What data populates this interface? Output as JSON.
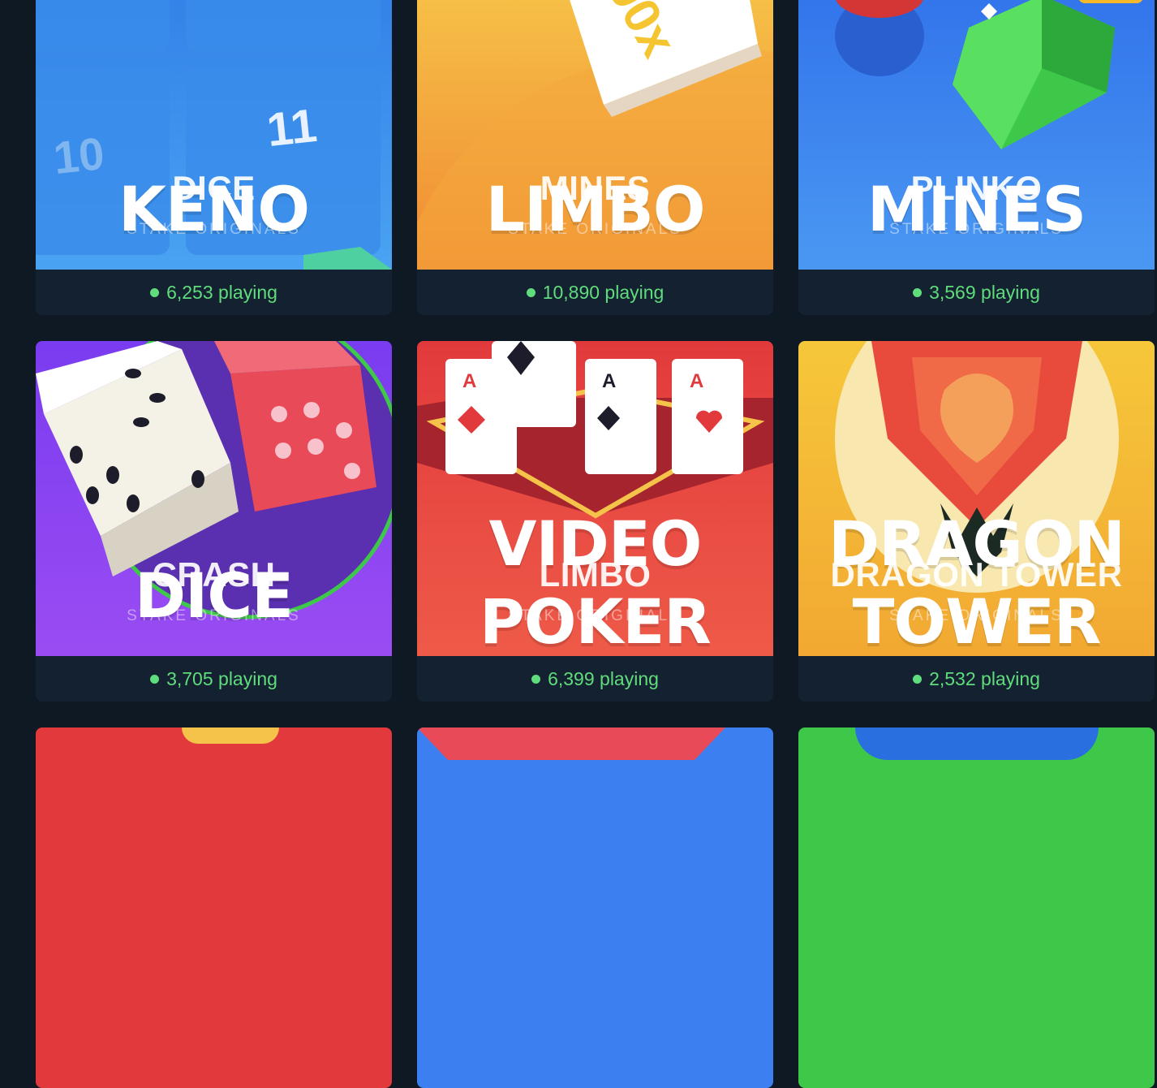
{
  "cards": [
    {
      "big": "KENO",
      "overlay": "DICE",
      "subtitle": "STAKE ORIGINALS",
      "playing": "6,253 playing",
      "bg": "#3b8ee8"
    },
    {
      "big": "LIMBO",
      "overlay": "MINES",
      "subtitle": "STAKE ORIGINALS",
      "playing": "10,890 playing",
      "bg": "#f5a033"
    },
    {
      "big": "MINES",
      "overlay": "PLINKO",
      "subtitle": "STAKE ORIGINALS",
      "playing": "3,569 playing",
      "bg": "#3c7ff0"
    },
    {
      "big": "DICE",
      "overlay": "CRASH",
      "subtitle": "STAKE ORIGINALS",
      "playing": "3,705 playing",
      "bg": "#8a48f0"
    },
    {
      "big_line1": "VIDEO",
      "big_line2": "POKER",
      "overlay": "LIMBO",
      "subtitle": "STAKE ORIGINALS",
      "playing": "6,399 playing",
      "bg": "#e8413f"
    },
    {
      "big_line1": "DRAGON",
      "big_line2": "TOWER",
      "overlay": "DRAGON TOWER",
      "subtitle": "STAKE ORIGINALS",
      "playing": "2,532 playing",
      "bg": "#f5c330"
    }
  ],
  "card_art": {
    "keno_numbers": [
      "10",
      "11"
    ],
    "limbo_multiplier": "00x",
    "poker_cards": [
      "A",
      "A",
      "A"
    ]
  },
  "icons": [
    "dice-icon",
    "gem-icon",
    "playing-card-icon",
    "dragon-icon",
    "online-dot-icon"
  ]
}
